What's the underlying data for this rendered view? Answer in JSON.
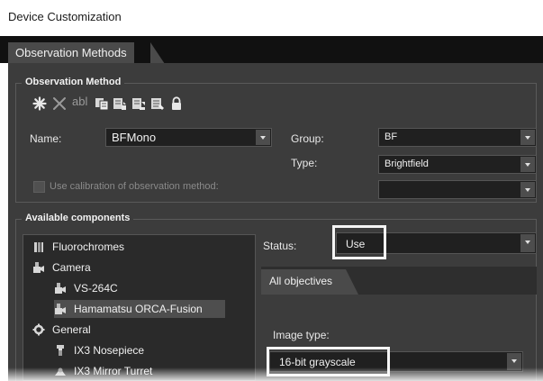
{
  "window": {
    "title": "Device Customization"
  },
  "main_tab": {
    "label": "Observation Methods"
  },
  "observation_method": {
    "section_title": "Observation Method",
    "toolbar": [
      {
        "icon": "new-asterisk-icon"
      },
      {
        "icon": "delete-x-icon"
      },
      {
        "icon": "rename-abl-icon",
        "text": "abl"
      },
      {
        "icon": "copy-icon"
      },
      {
        "icon": "import-icon"
      },
      {
        "icon": "export-icon"
      },
      {
        "icon": "properties-icon"
      },
      {
        "icon": "lock-icon"
      }
    ],
    "name_label": "Name:",
    "name_value": "BFMono",
    "group_label": "Group:",
    "group_value": "BF",
    "type_label": "Type:",
    "type_value": "Brightfield",
    "calibration_label": "Use calibration of observation method:",
    "calibration_value": ""
  },
  "available_components": {
    "section_title": "Available components",
    "items": [
      {
        "label": "Fluorochromes",
        "icon": "fluorochromes-icon",
        "level": 0
      },
      {
        "label": "Camera",
        "icon": "camera-icon",
        "level": 0
      },
      {
        "label": "VS-264C",
        "icon": "camera-icon",
        "level": 1
      },
      {
        "label": "Hamamatsu ORCA-Fusion",
        "icon": "camera-icon",
        "level": 1,
        "selected": true
      },
      {
        "label": "General",
        "icon": "general-icon",
        "level": 0
      },
      {
        "label": "IX3 Nosepiece",
        "icon": "nosepiece-icon",
        "level": 1
      },
      {
        "label": "IX3 Mirror Turret",
        "icon": "mirror-turret-icon",
        "level": 1
      }
    ]
  },
  "properties": {
    "status_label": "Status:",
    "status_value": "Use",
    "objectives_tab": "All objectives",
    "image_type_label": "Image type:",
    "image_type_value": "16-bit grayscale"
  }
}
